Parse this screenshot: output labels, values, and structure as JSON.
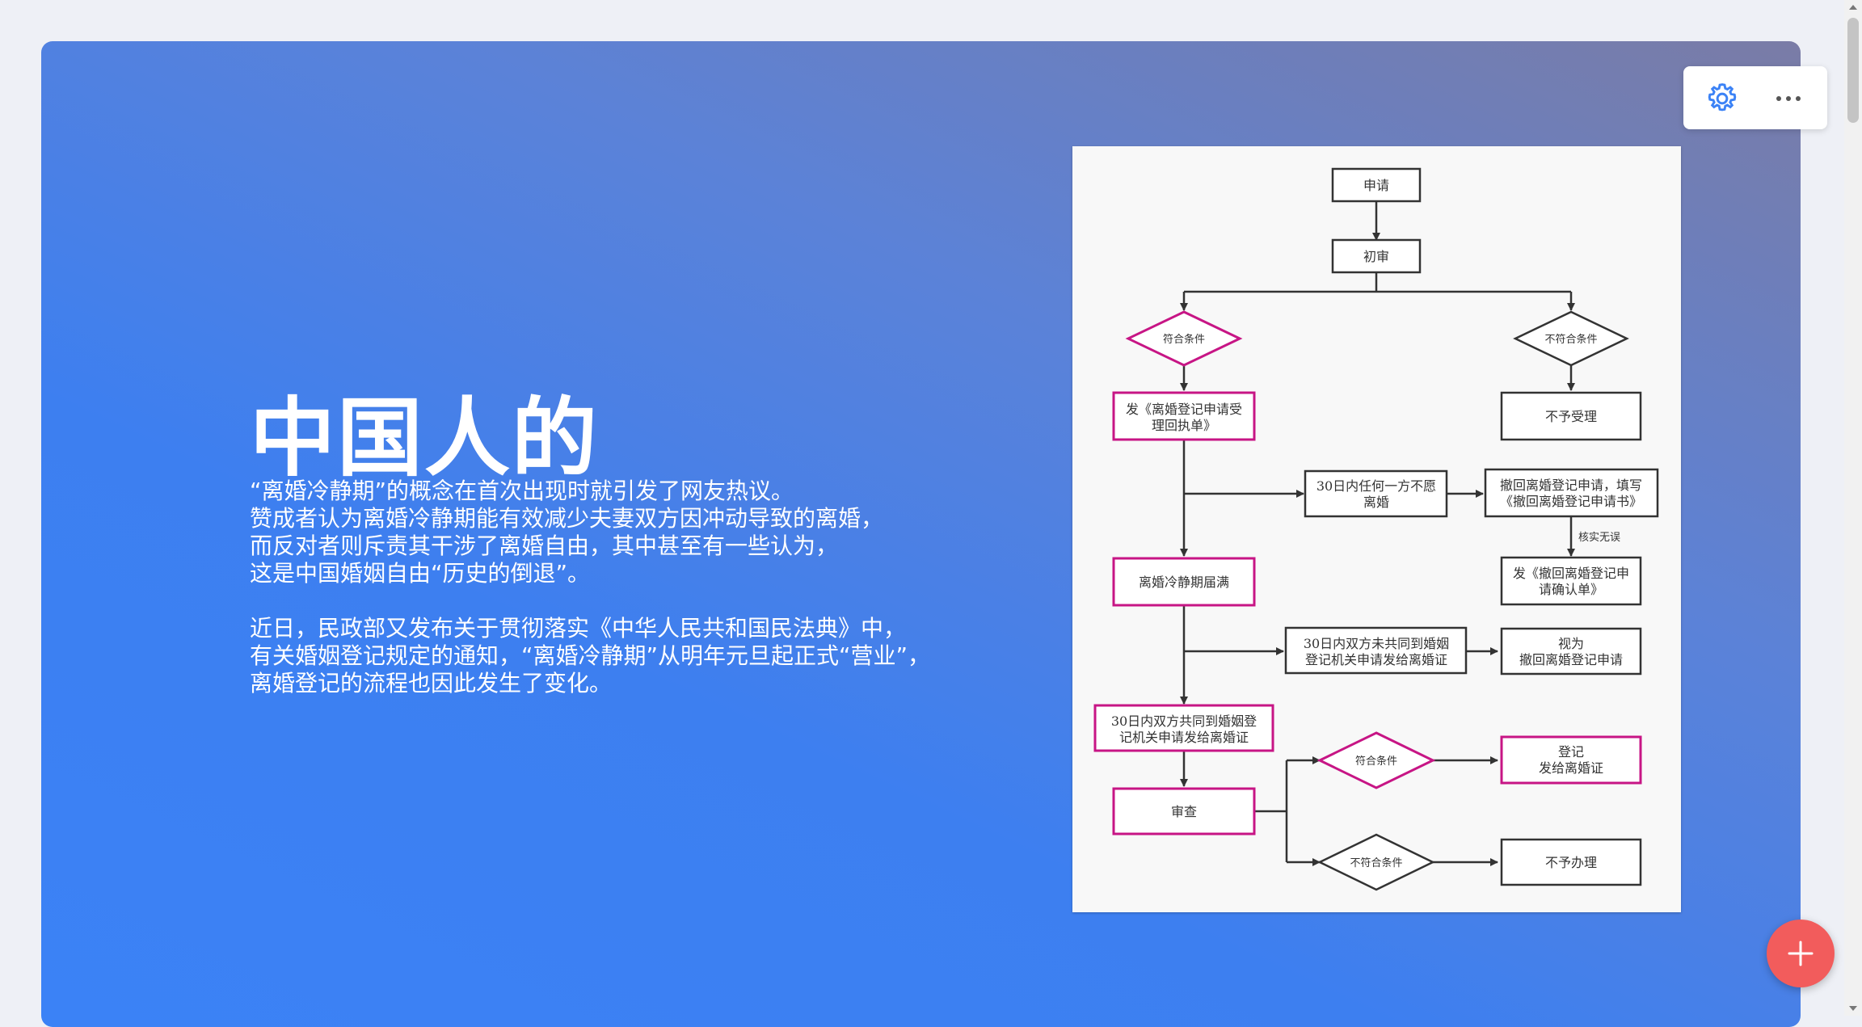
{
  "slide": {
    "title": "中国人的",
    "paragraph1": [
      "“离婚冷静期”的概念在首次出现时就引发了网友热议。",
      "赞成者认为离婚冷静期能有效减少夫妻双方因冲动导致的离婚，",
      "而反对者则斥责其干涉了离婚自由，其中甚至有一些认为，",
      "这是中国婚姻自由“历史的倒退”。"
    ],
    "paragraph2": [
      "近日，民政部又发布关于贯彻落实《中华人民共和国民法典》中，",
      "有关婚姻登记规定的通知，“离婚冷静期”从明年元旦起正式“营业”，",
      "离婚登记的流程也因此发生了变化。"
    ]
  },
  "flowchart": {
    "apply": "申请",
    "initial_review": "初审",
    "meets": "符合条件",
    "not_meets": "不符合条件",
    "issue_receipt": [
      "发《离婚登记申请受",
      "理回执单》"
    ],
    "not_accepted": "不予受理",
    "withdraw_any": [
      "30日内任何一方不愿",
      "离婚"
    ],
    "withdraw_app": [
      "撤回离婚登记申请，填写",
      "《撤回离婚登记申请书》"
    ],
    "verified": "核实无误",
    "issue_confirm": [
      "发《撤回离婚登记申",
      "请确认单》"
    ],
    "cooling_end": "离婚冷静期届满",
    "not_both": [
      "30日内双方未共同到婚姻",
      "登记机关申请发给离婚证"
    ],
    "deemed": [
      "视为",
      "撤回离婚登记申请"
    ],
    "both": [
      "30日内双方共同到婚姻登",
      "记机关申请发给离婚证"
    ],
    "review": "审查",
    "meets2": "符合条件",
    "register": [
      "登记",
      "发给离婚证"
    ],
    "not_meets2": "不符合条件",
    "not_handle": "不予办理"
  },
  "icons": {
    "settings": "gear-icon",
    "more": "more-horizontal-icon",
    "fab": "plus-icon"
  },
  "colors": {
    "accent_pink": "#c71585",
    "fab_red": "#f25c5c",
    "settings_blue": "#3b82f6"
  }
}
